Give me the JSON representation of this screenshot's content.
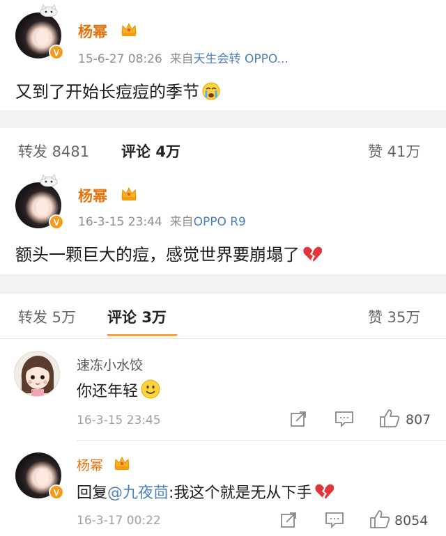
{
  "posts": [
    {
      "author": "杨幂",
      "time": "15-6-27 08:26",
      "source_prefix": "来自",
      "source": "天生会转 OPPO...",
      "text": "又到了开始长痘痘的季节",
      "emoji": "crying-face-icon",
      "reposts_label": "转发 8481",
      "comments_label": "评论",
      "comments_count": "4万",
      "likes_label": "赞 41万",
      "verified_badge": "V"
    },
    {
      "author": "杨幂",
      "time": "16-3-15 23:44",
      "source_prefix": "来自",
      "source": "OPPO R9",
      "text": "额头一颗巨大的痘，感觉世界要崩塌了",
      "emoji": "broken-heart-icon",
      "reposts_label": "转发 5万",
      "comments_label": "评论",
      "comments_count": "3万",
      "likes_label": "赞 35万",
      "verified_badge": "V"
    }
  ],
  "comments": [
    {
      "author": "速冻小水饺",
      "text": "你还年轻",
      "emoji": "smile-icon",
      "time": "16-3-15 23:45",
      "likes": "807"
    },
    {
      "author": "杨幂",
      "reply_prefix": "回复",
      "mention": "@九夜茴",
      "text": ":我这个就是无从下手",
      "emoji": "broken-heart-icon",
      "time": "16-3-17 00:22",
      "likes": "8054",
      "verified_badge": "V"
    }
  ],
  "colors": {
    "name_orange": "#e8720e",
    "link_blue": "#4f7fb8",
    "tab_underline": "#f7a03a",
    "gap_gray": "#f2f2f2"
  }
}
